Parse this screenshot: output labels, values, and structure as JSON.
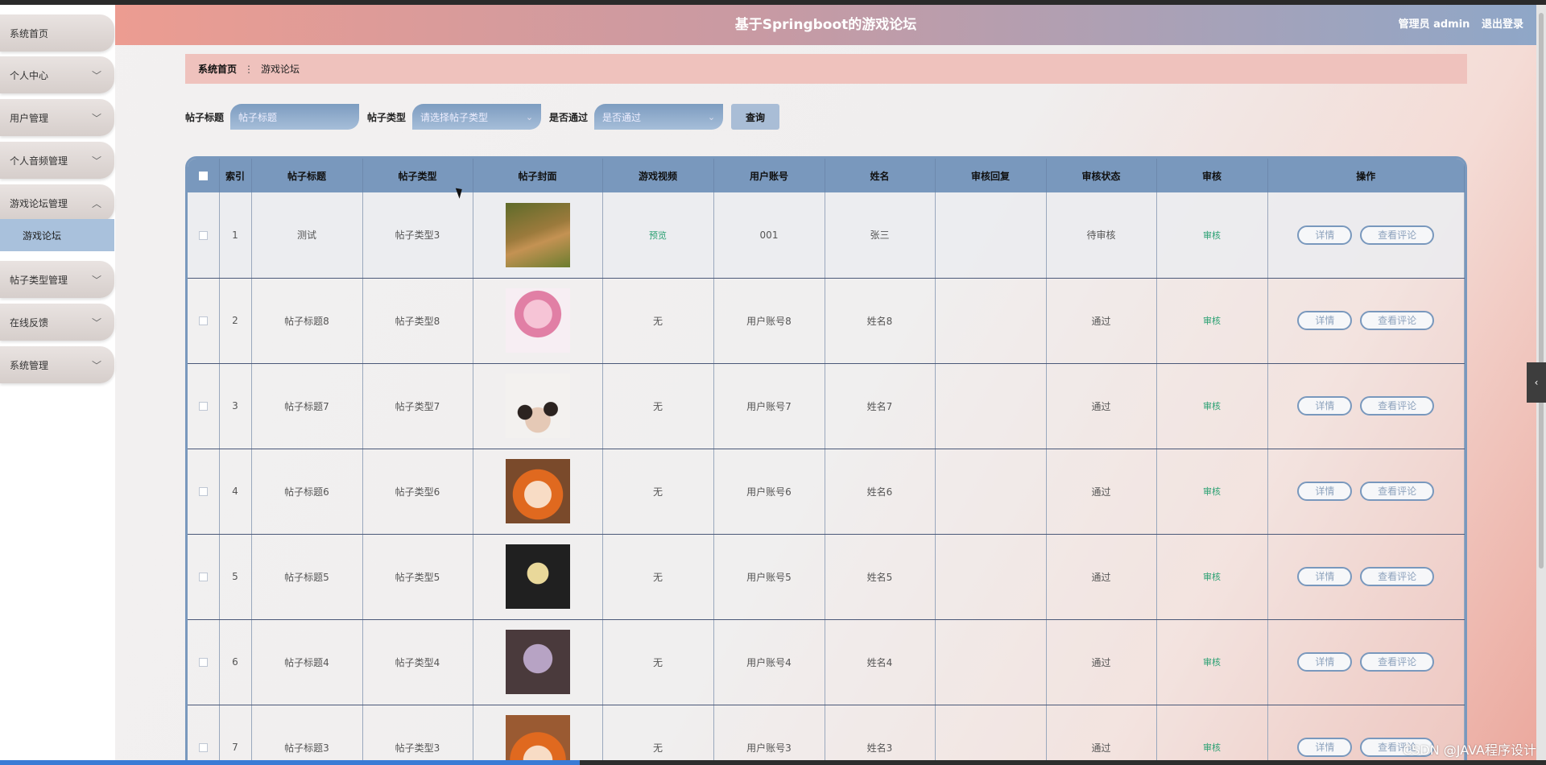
{
  "header": {
    "title": "基于Springboot的游戏论坛",
    "user_label": "管理员 admin",
    "logout_label": "退出登录"
  },
  "sidebar": {
    "items": [
      {
        "label": "系统首页",
        "has_chevron": false
      },
      {
        "label": "个人中心",
        "chevron": "﹀"
      },
      {
        "label": "用户管理",
        "chevron": "﹀"
      },
      {
        "label": "个人音频管理",
        "chevron": "﹀"
      },
      {
        "label": "游戏论坛管理",
        "chevron": "︿"
      },
      {
        "label": "帖子类型管理",
        "chevron": "﹀"
      },
      {
        "label": "在线反馈",
        "chevron": "﹀"
      },
      {
        "label": "系统管理",
        "chevron": "﹀"
      }
    ],
    "active_sub_item": "游戏论坛"
  },
  "breadcrumb": {
    "home": "系统首页",
    "separator": "⋮",
    "current": "游戏论坛"
  },
  "search": {
    "title_label": "帖子标题",
    "title_placeholder": "帖子标题",
    "type_label": "帖子类型",
    "type_placeholder": "请选择帖子类型",
    "passed_label": "是否通过",
    "passed_placeholder": "是否通过",
    "button_label": "查询"
  },
  "table": {
    "columns": [
      "索引",
      "帖子标题",
      "帖子类型",
      "帖子封面",
      "游戏视频",
      "用户账号",
      "姓名",
      "审核回复",
      "审核状态",
      "审核",
      "操作"
    ],
    "detail_label": "详情",
    "comments_label": "查看评论",
    "rows": [
      {
        "index": "1",
        "title": "测试",
        "type": "帖子类型3",
        "video": "预览",
        "account": "001",
        "name": "张三",
        "reply": "",
        "status": "待审核",
        "review": "审核"
      },
      {
        "index": "2",
        "title": "帖子标题8",
        "type": "帖子类型8",
        "video": "无",
        "account": "用户账号8",
        "name": "姓名8",
        "reply": "",
        "status": "通过",
        "review": "审核"
      },
      {
        "index": "3",
        "title": "帖子标题7",
        "type": "帖子类型7",
        "video": "无",
        "account": "用户账号7",
        "name": "姓名7",
        "reply": "",
        "status": "通过",
        "review": "审核"
      },
      {
        "index": "4",
        "title": "帖子标题6",
        "type": "帖子类型6",
        "video": "无",
        "account": "用户账号6",
        "name": "姓名6",
        "reply": "",
        "status": "通过",
        "review": "审核"
      },
      {
        "index": "5",
        "title": "帖子标题5",
        "type": "帖子类型5",
        "video": "无",
        "account": "用户账号5",
        "name": "姓名5",
        "reply": "",
        "status": "通过",
        "review": "审核"
      },
      {
        "index": "6",
        "title": "帖子标题4",
        "type": "帖子类型4",
        "video": "无",
        "account": "用户账号4",
        "name": "姓名4",
        "reply": "",
        "status": "通过",
        "review": "审核"
      },
      {
        "index": "7",
        "title": "帖子标题3",
        "type": "帖子类型3",
        "video": "无",
        "account": "用户账号3",
        "name": "姓名3",
        "reply": "",
        "status": "通过",
        "review": "审核"
      }
    ]
  },
  "watermark": "CSDN @JAVA程序设计",
  "colors": {
    "accent": "#7998bd",
    "header_left": "#ec9c91",
    "header_right": "#8ea7c8",
    "breadcrumb_bg": "#efc2bd",
    "link_green": "#2aa072"
  }
}
